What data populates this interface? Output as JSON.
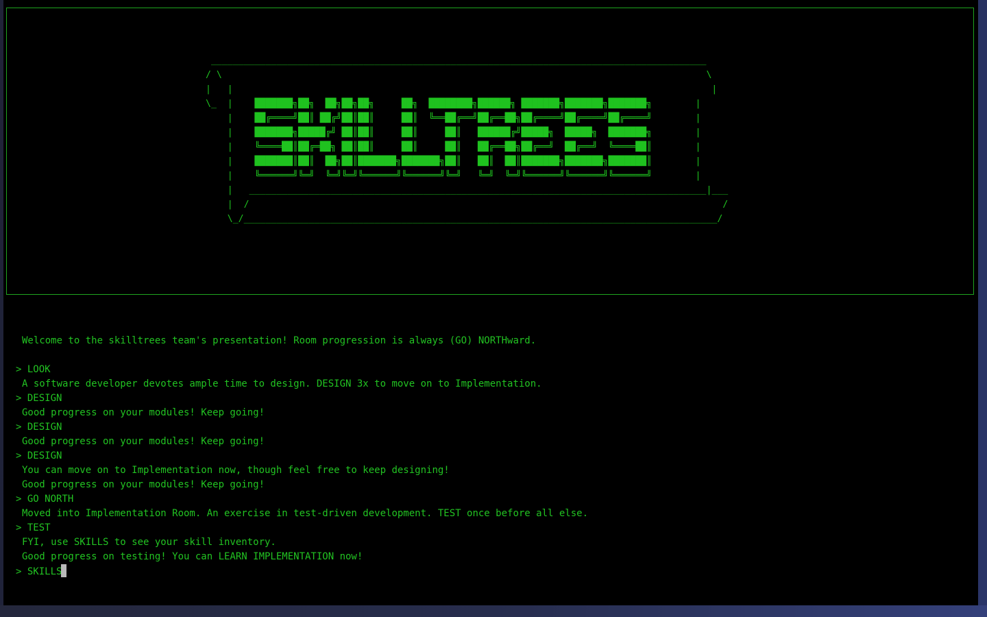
{
  "banner": {
    "art": " ___________________________________________________________________________________________\n/ \\                                                                                         \\\n|   |                                                                                        |\n\\_  |    ███████╗██╗  ██╗██╗██╗     ██╗  ████████╗██████╗ ███████╗███████╗███████╗        |\n    |    ██╔════╝██║ ██╔╝██║██║     ██║  ╚══██╔══╝██╔══██╗██╔════╝██╔════╝██╔════╝        |\n    |    ███████╗█████╔╝ ██║██║     ██║     ██║   ██████╔╝█████╗  █████╗  ███████╗        |\n    |    ╚════██║██╔═██╗ ██║██║     ██║     ██║   ██╔══██╗██╔══╝  ██╔══╝  ╚════██║        |\n    |    ███████║██║  ██╗██║███████╗███████╗██║   ██║  ██║███████╗███████╗███████║        |\n    |    ╚══════╝╚═╝  ╚═╝╚═╝╚══════╝╚══════╝╚═╝   ╚═╝  ╚═╝╚══════╝╚══════╝╚══════╝        |\n    |   ____________________________________________________________________________________|___\n    |  /                                                                                       /\n    \\_/_______________________________________________________________________________________/"
  },
  "log": [
    {
      "kind": "blank",
      "text": ""
    },
    {
      "kind": "resp",
      "text": "Welcome to the skilltrees team's presentation! Room progression is always (GO) NORTHward."
    },
    {
      "kind": "blank",
      "text": ""
    },
    {
      "kind": "cmd",
      "text": "> LOOK"
    },
    {
      "kind": "resp",
      "text": "A software developer devotes ample time to design. DESIGN 3x to move on to Implementation."
    },
    {
      "kind": "cmd",
      "text": "> DESIGN"
    },
    {
      "kind": "resp",
      "text": "Good progress on your modules! Keep going!"
    },
    {
      "kind": "cmd",
      "text": "> DESIGN"
    },
    {
      "kind": "resp",
      "text": "Good progress on your modules! Keep going!"
    },
    {
      "kind": "cmd",
      "text": "> DESIGN"
    },
    {
      "kind": "resp",
      "text": "You can move on to Implementation now, though feel free to keep designing!"
    },
    {
      "kind": "resp",
      "text": "Good progress on your modules! Keep going!"
    },
    {
      "kind": "cmd",
      "text": "> GO NORTH"
    },
    {
      "kind": "resp",
      "text": "Moved into Implementation Room. An exercise in test-driven development. TEST once before all else."
    },
    {
      "kind": "cmd",
      "text": "> TEST"
    },
    {
      "kind": "resp",
      "text": "FYI, use SKILLS to see your skill inventory."
    },
    {
      "kind": "resp",
      "text": "Good progress on testing! You can LEARN IMPLEMENTATION now!"
    }
  ],
  "prompt": {
    "prefix": "> ",
    "input_value": "SKILLS"
  },
  "colors": {
    "terminal_bg": "#000000",
    "text_green": "#22c322",
    "border_green": "#1fa51f",
    "cursor": "#b9b9b9"
  }
}
